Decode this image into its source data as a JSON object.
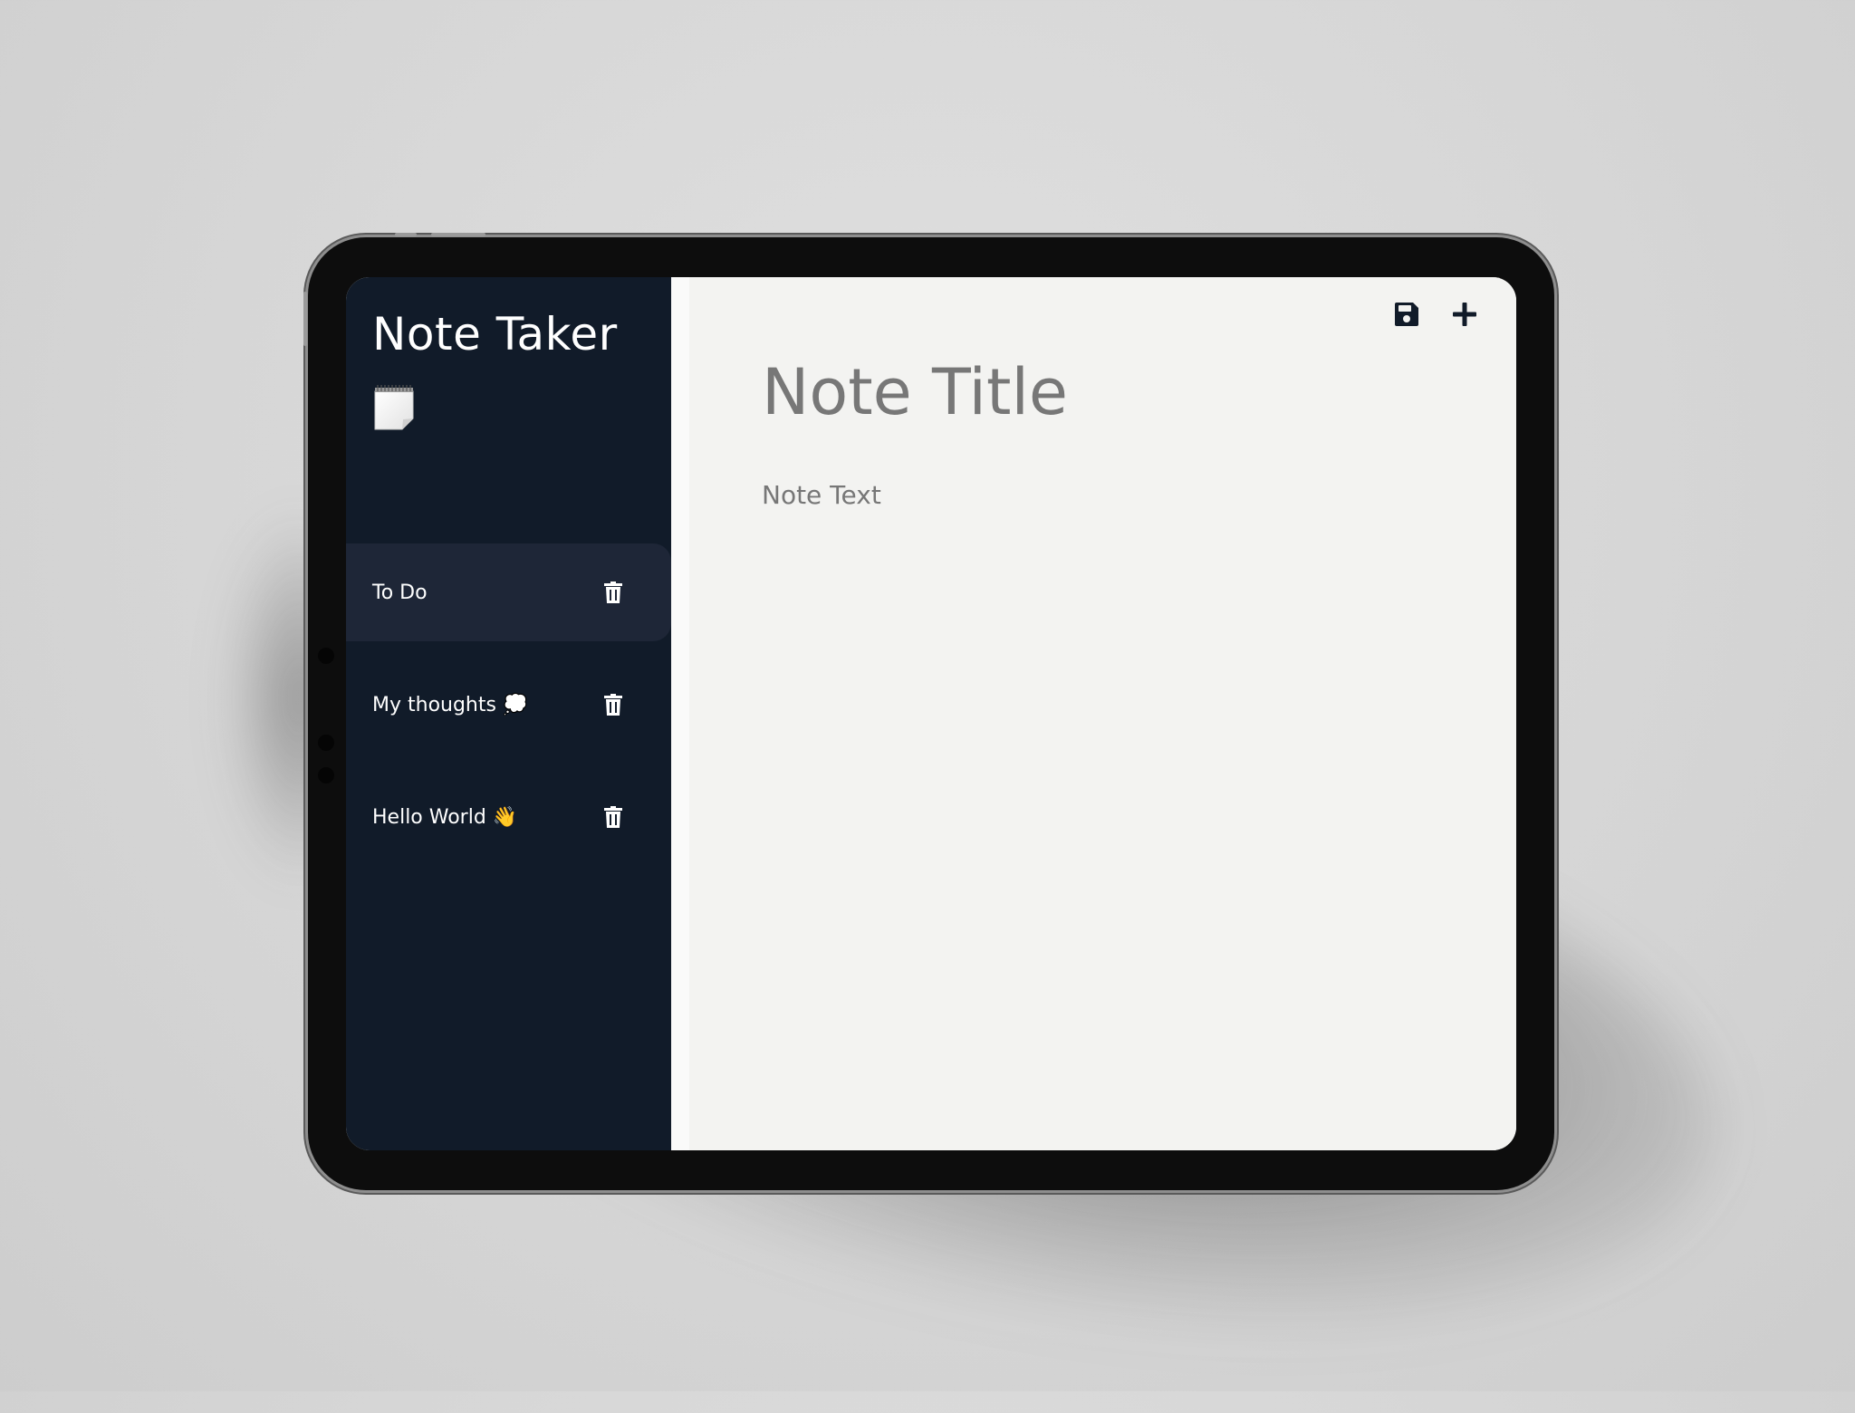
{
  "app": {
    "title": "Note Taker"
  },
  "sidebar": {
    "notes": [
      {
        "label": "To Do",
        "active": true
      },
      {
        "label": "My thoughts 💭",
        "active": false
      },
      {
        "label": "Hello World 👋",
        "active": false
      }
    ]
  },
  "editor": {
    "title_placeholder": "Note Title",
    "text_placeholder": "Note Text"
  },
  "icons": {
    "app": "notepad-icon",
    "save": "save-icon",
    "new": "plus-icon",
    "delete": "trash-icon"
  },
  "colors": {
    "sidebar_bg": "#111b29",
    "active_item_bg": "#1e2637",
    "editor_bg": "#f3f3f1",
    "placeholder_text": "#777777",
    "sidebar_text": "#ffffff",
    "toolbar_icon": "#111b29"
  }
}
